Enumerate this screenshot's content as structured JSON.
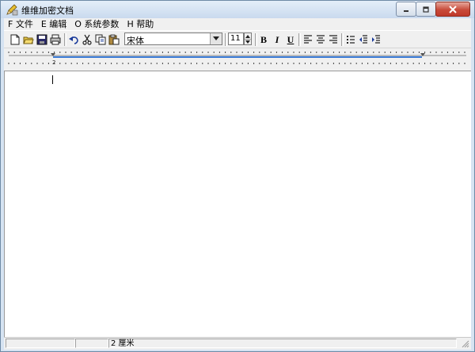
{
  "window": {
    "title": "维维加密文档",
    "app_icon": "pencil-app-icon",
    "controls": {
      "minimize_icon": "minimize-icon",
      "maximize_icon": "maximize-icon",
      "close_icon": "close-icon"
    }
  },
  "menu": {
    "items": [
      {
        "label": "F 文件"
      },
      {
        "label": "E 编辑"
      },
      {
        "label": "O 系统参数"
      },
      {
        "label": "H 帮助"
      }
    ]
  },
  "toolbar": {
    "buttons": [
      {
        "icon": "new-document-icon"
      },
      {
        "icon": "open-folder-icon"
      },
      {
        "icon": "save-icon"
      },
      {
        "icon": "print-icon"
      },
      {
        "icon": "undo-icon"
      },
      {
        "icon": "cut-icon"
      },
      {
        "icon": "copy-icon"
      },
      {
        "icon": "paste-icon"
      }
    ],
    "font_name": "宋体",
    "font_size": "11",
    "format_buttons": [
      {
        "icon": "bold-icon",
        "label": "B"
      },
      {
        "icon": "italic-icon",
        "label": "I"
      },
      {
        "icon": "underline-icon",
        "label": "U"
      },
      {
        "icon": "align-left-icon"
      },
      {
        "icon": "align-center-icon"
      },
      {
        "icon": "align-right-icon"
      },
      {
        "icon": "bullet-list-icon"
      },
      {
        "icon": "decrease-indent-icon"
      },
      {
        "icon": "increase-indent-icon"
      }
    ]
  },
  "ruler": {
    "label": "2",
    "accent_color": "#3a7bd5"
  },
  "editor": {
    "content": ""
  },
  "statusbar": {
    "panes": [
      {
        "text": ""
      },
      {
        "text": ""
      },
      {
        "text": "2 厘米"
      }
    ]
  }
}
